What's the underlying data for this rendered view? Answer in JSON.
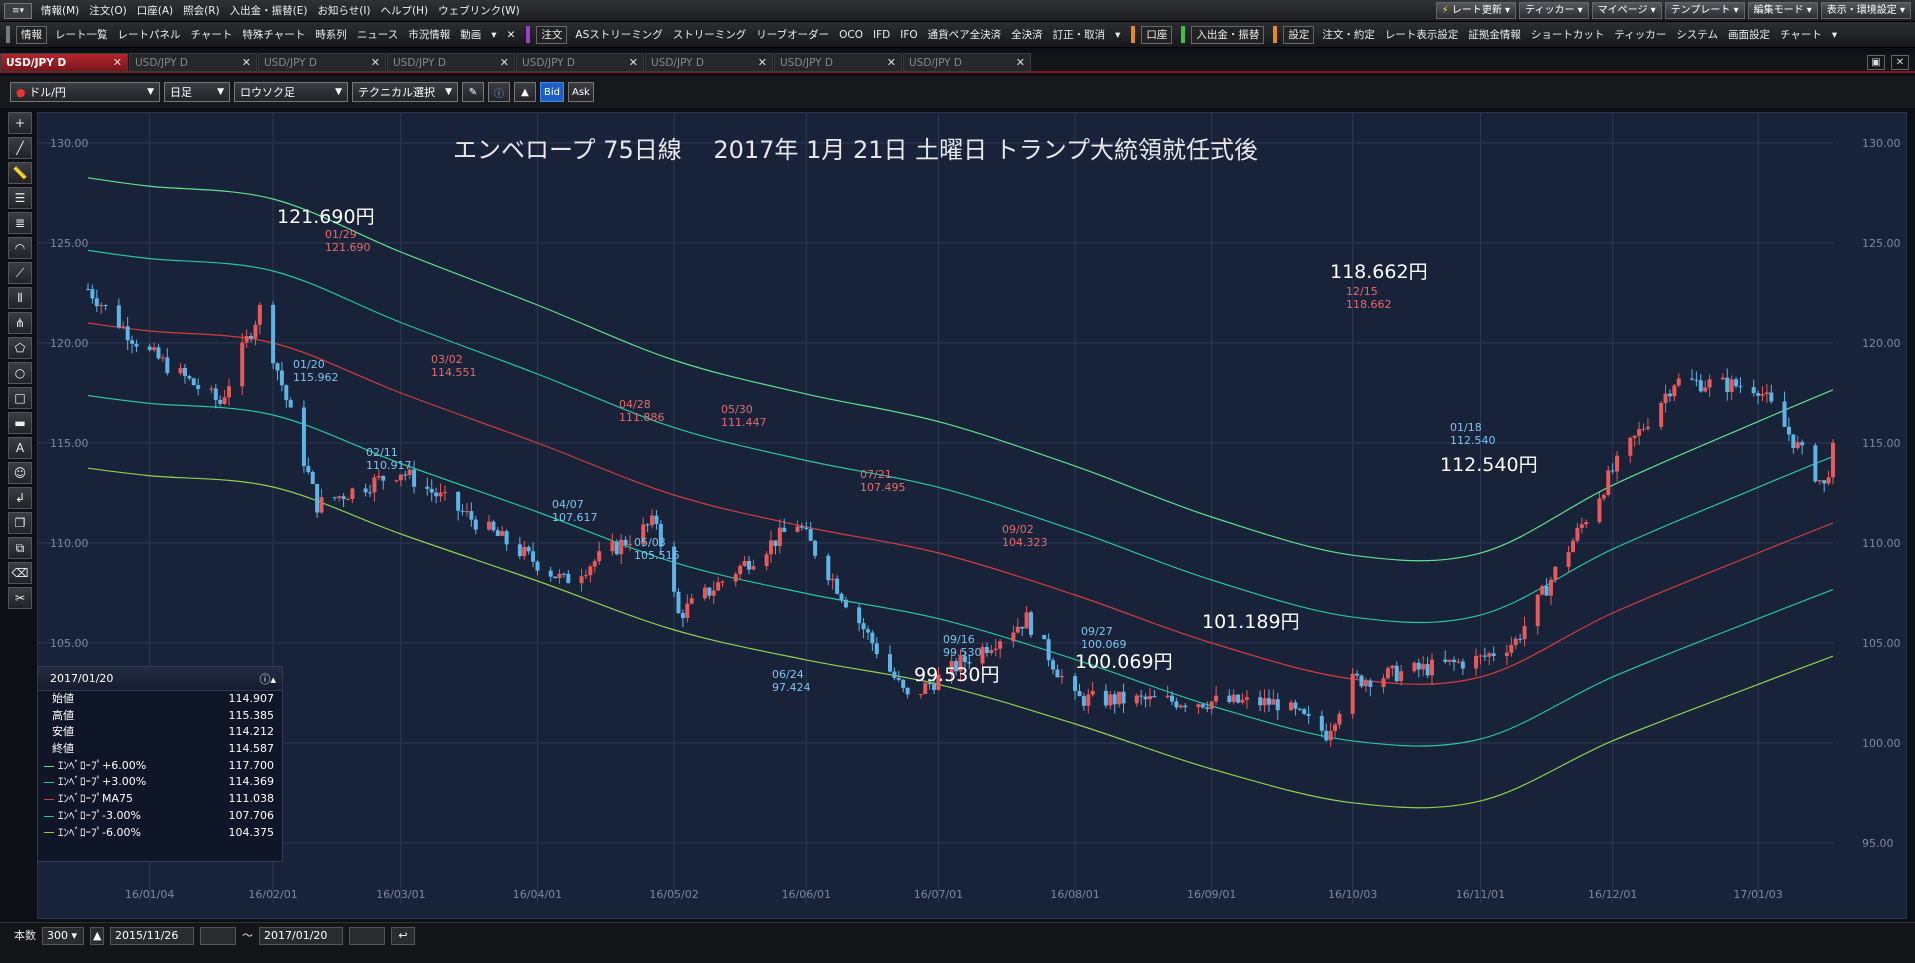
{
  "menubar": {
    "items": [
      "情報(M)",
      "注文(O)",
      "口座(A)",
      "照会(R)",
      "入出金・振替(E)",
      "お知らせ(I)",
      "ヘルプ(H)",
      "ウェブリンク(W)"
    ],
    "right_buttons": [
      "レート更新",
      "ティッカー",
      "マイページ",
      "テンプレート",
      "編集モード",
      "表示・環境設定"
    ]
  },
  "toolbar": {
    "group1_label": "情報",
    "group1": [
      "レート一覧",
      "レートパネル",
      "チャート",
      "特殊チャート",
      "時系列",
      "ニュース",
      "市況情報",
      "動画"
    ],
    "group2_label": "注文",
    "group2": [
      "ASストリーミング",
      "ストリーミング",
      "リーブオーダー",
      "OCO",
      "IFD",
      "IFO",
      "通貨ペア全決済",
      "全決済",
      "訂正・取消"
    ],
    "group3_label": "口座",
    "group4_label": "入出金・振替",
    "group5_label": "設定",
    "group5": [
      "注文・約定",
      "レート表示設定",
      "証拠金情報",
      "ショートカット",
      "ティッカー",
      "システム",
      "画面設定",
      "チャート"
    ]
  },
  "tabs": [
    "USD/JPY D",
    "USD/JPY D",
    "USD/JPY D",
    "USD/JPY D",
    "USD/JPY D",
    "USD/JPY D",
    "USD/JPY D",
    "USD/JPY D"
  ],
  "controls": {
    "pair": "ドル/円",
    "period": "日足",
    "style": "ロウソク足",
    "technical": "テクニカル選択",
    "bid": "Bid",
    "ask": "Ask"
  },
  "infobox": {
    "date": "2017/01/20",
    "rows": [
      {
        "label": "始値",
        "value": "114.907",
        "color": ""
      },
      {
        "label": "高値",
        "value": "115.385",
        "color": ""
      },
      {
        "label": "安値",
        "value": "114.212",
        "color": ""
      },
      {
        "label": "終値",
        "value": "114.587",
        "color": ""
      },
      {
        "label": "ｴﾝﾍﾞﾛｰﾌﾟ+6.00%",
        "value": "117.700",
        "color": "#5fe08a"
      },
      {
        "label": "ｴﾝﾍﾞﾛｰﾌﾟ+3.00%",
        "value": "114.369",
        "color": "#27c4a0"
      },
      {
        "label": "ｴﾝﾍﾞﾛｰﾌﾟMA75",
        "value": "111.038",
        "color": "#d83a3a"
      },
      {
        "label": "ｴﾝﾍﾞﾛｰﾌﾟ-3.00%",
        "value": "107.706",
        "color": "#27c4a0"
      },
      {
        "label": "ｴﾝﾍﾞﾛｰﾌﾟ-6.00%",
        "value": "104.375",
        "color": "#8fd04a"
      }
    ]
  },
  "bottom": {
    "count_label": "本数",
    "count": "300",
    "from": "2015/11/26",
    "tilde": "～",
    "to": "2017/01/20"
  },
  "chart_data": {
    "type": "candlestick",
    "title": "エンベロープ 75日線　 2017年 1月 21日 土曜日 トランプ大統領就任式後",
    "ylim": [
      93.5,
      131.5
    ],
    "y_ticks": [
      95,
      100,
      105,
      110,
      115,
      120,
      125,
      130
    ],
    "y_tick_labels": [
      "95.00",
      "100.00",
      "105.00",
      "110.00",
      "115.00",
      "120.00",
      "125.00",
      "130.00"
    ],
    "x_ticks": [
      "16/01/04",
      "16/02/01",
      "16/03/01",
      "16/04/01",
      "16/05/02",
      "16/06/01",
      "16/07/01",
      "16/08/01",
      "16/09/01",
      "16/10/03",
      "16/11/01",
      "16/12/01",
      "17/01/03"
    ],
    "grid": true,
    "colors": {
      "up": "#e85a5a",
      "down": "#5fb4e6",
      "ma": "#d83a3a",
      "env3": "#27c4a0",
      "env6_up": "#5fe08a",
      "env6_down": "#8fd04a",
      "bg": "#182339"
    },
    "envelope": {
      "dates": [
        "15/12/21",
        "16/01/04",
        "16/02/01",
        "16/03/01",
        "16/04/01",
        "16/05/02",
        "16/06/01",
        "16/07/01",
        "16/08/01",
        "16/09/01",
        "16/10/03",
        "16/11/01",
        "16/12/01",
        "17/01/03",
        "17/01/20"
      ],
      "ma75": [
        121.0,
        120.6,
        120.0,
        117.5,
        115.0,
        112.4,
        110.8,
        109.5,
        107.4,
        105.0,
        103.2,
        103.3,
        106.5,
        109.5,
        111.0
      ]
    },
    "candles": [
      {
        "date": "15/12/21",
        "close": 122.7
      },
      {
        "date": "15/12/31",
        "close": 120.3
      },
      {
        "date": "16/01/04",
        "close": 119.5
      },
      {
        "date": "16/01/20",
        "close": 117.0
      },
      {
        "date": "16/01/29",
        "close": 121.69
      },
      {
        "date": "16/02/11",
        "close": 111.9
      },
      {
        "date": "16/03/01",
        "close": 113.6
      },
      {
        "date": "16/04/07",
        "close": 108.1
      },
      {
        "date": "16/04/28",
        "close": 111.1
      },
      {
        "date": "16/05/03",
        "close": 106.4
      },
      {
        "date": "16/05/30",
        "close": 111.0
      },
      {
        "date": "16/06/24",
        "close": 102.2
      },
      {
        "date": "16/07/21",
        "close": 106.2
      },
      {
        "date": "16/08/01",
        "close": 102.2
      },
      {
        "date": "16/09/16",
        "close": 102.0
      },
      {
        "date": "16/09/27",
        "close": 100.5
      },
      {
        "date": "16/10/03",
        "close": 103.1
      },
      {
        "date": "16/11/01",
        "close": 104.2
      },
      {
        "date": "16/11/09",
        "close": 105.1
      },
      {
        "date": "16/12/01",
        "close": 113.6
      },
      {
        "date": "16/12/15",
        "close": 118.1
      },
      {
        "date": "17/01/03",
        "close": 117.8
      },
      {
        "date": "17/01/18",
        "close": 112.8
      },
      {
        "date": "17/01/20",
        "close": 114.587
      }
    ],
    "annotations_small": [
      {
        "date": "01/29",
        "value": "121.690",
        "kind": "high"
      },
      {
        "date": "01/20",
        "value": "115.962",
        "kind": "low"
      },
      {
        "date": "03/02",
        "value": "114.551",
        "kind": "high"
      },
      {
        "date": "02/11",
        "value": "110.917",
        "kind": "low"
      },
      {
        "date": "04/28",
        "value": "111.886",
        "kind": "high"
      },
      {
        "date": "04/07",
        "value": "107.617",
        "kind": "low"
      },
      {
        "date": "05/03",
        "value": "105.516",
        "kind": "low"
      },
      {
        "date": "05/30",
        "value": "111.447",
        "kind": "high"
      },
      {
        "date": "06/24",
        "value": "97.424",
        "kind": "low"
      },
      {
        "date": "07/21",
        "value": "107.495",
        "kind": "high"
      },
      {
        "date": "09/02",
        "value": "104.323",
        "kind": "high"
      },
      {
        "date": "09/16",
        "value": "99.530",
        "kind": "low"
      },
      {
        "date": "09/27",
        "value": "100.069",
        "kind": "low"
      },
      {
        "date": "12/15",
        "value": "118.662",
        "kind": "high"
      },
      {
        "date": "01/18",
        "value": "112.540",
        "kind": "low"
      }
    ],
    "annotations_big": [
      "121.690円",
      "118.662円",
      "112.540円",
      "101.189円",
      "99.530円",
      "100.069円"
    ]
  }
}
